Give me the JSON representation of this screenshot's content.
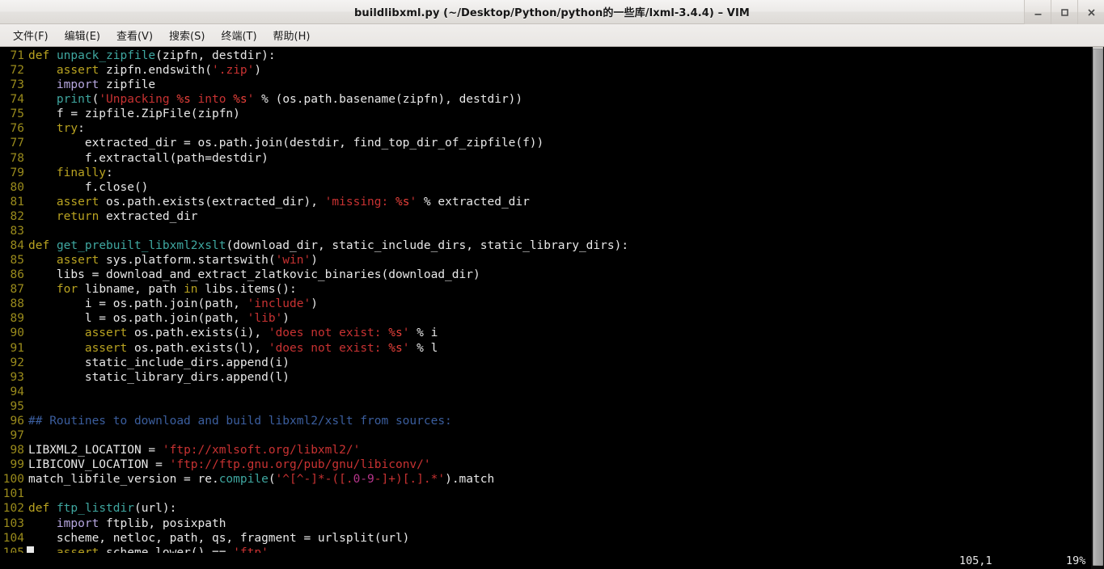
{
  "window": {
    "title": "buildlibxml.py (~/Desktop/Python/python的一些库/lxml-3.4.4) – VIM",
    "controls": {
      "minimize": "minimize-icon",
      "maximize": "maximize-icon",
      "close": "close-icon"
    }
  },
  "menubar": {
    "items": [
      {
        "label": "文件(F)",
        "name": "menu-file"
      },
      {
        "label": "编辑(E)",
        "name": "menu-edit"
      },
      {
        "label": "查看(V)",
        "name": "menu-view"
      },
      {
        "label": "搜索(S)",
        "name": "menu-search"
      },
      {
        "label": "终端(T)",
        "name": "menu-terminal"
      },
      {
        "label": "帮助(H)",
        "name": "menu-help"
      }
    ]
  },
  "colors": {
    "background": "#000000",
    "foreground": "#e8e8e8",
    "line_number": "#9a8b1c",
    "keyword": "#b9a321",
    "function": "#3fa7a0",
    "preproc": "#b7a7e0",
    "string": "#c83232",
    "format_spec": "#e8413b",
    "number": "#b5358a",
    "comment": "#3b5e9e",
    "titlebar": "#eceae8",
    "menubar": "#e9e6e3",
    "scrollbar_thumb": "#a9a9a9"
  },
  "editor": {
    "first_line": 71,
    "last_line": 105,
    "cursor": {
      "line": 105,
      "column": 1
    },
    "lines": [
      {
        "n": "71",
        "tokens": [
          {
            "t": "def",
            "c": "kw"
          },
          {
            "t": " ",
            "c": "norm"
          },
          {
            "t": "unpack_zipfile",
            "c": "fn"
          },
          {
            "t": "(zipfn, destdir):",
            "c": "norm"
          }
        ]
      },
      {
        "n": "72",
        "tokens": [
          {
            "t": "    ",
            "c": "norm"
          },
          {
            "t": "assert",
            "c": "kw"
          },
          {
            "t": " zipfn.endswith(",
            "c": "norm"
          },
          {
            "t": "'.zip'",
            "c": "str"
          },
          {
            "t": ")",
            "c": "norm"
          }
        ]
      },
      {
        "n": "73",
        "tokens": [
          {
            "t": "    ",
            "c": "norm"
          },
          {
            "t": "import",
            "c": "pre"
          },
          {
            "t": " zipfile",
            "c": "norm"
          }
        ]
      },
      {
        "n": "74",
        "tokens": [
          {
            "t": "    ",
            "c": "norm"
          },
          {
            "t": "print",
            "c": "fn"
          },
          {
            "t": "(",
            "c": "norm"
          },
          {
            "t": "'Unpacking ",
            "c": "str"
          },
          {
            "t": "%s",
            "c": "fmt"
          },
          {
            "t": " into ",
            "c": "str"
          },
          {
            "t": "%s",
            "c": "fmt"
          },
          {
            "t": "'",
            "c": "str"
          },
          {
            "t": " % (os.path.basename(zipfn), destdir))",
            "c": "norm"
          }
        ]
      },
      {
        "n": "75",
        "tokens": [
          {
            "t": "    f = zipfile.ZipFile(zipfn)",
            "c": "norm"
          }
        ]
      },
      {
        "n": "76",
        "tokens": [
          {
            "t": "    ",
            "c": "norm"
          },
          {
            "t": "try",
            "c": "kw"
          },
          {
            "t": ":",
            "c": "norm"
          }
        ]
      },
      {
        "n": "77",
        "tokens": [
          {
            "t": "        extracted_dir = os.path.join(destdir, find_top_dir_of_zipfile(f))",
            "c": "norm"
          }
        ]
      },
      {
        "n": "78",
        "tokens": [
          {
            "t": "        f.extractall(path=destdir)",
            "c": "norm"
          }
        ]
      },
      {
        "n": "79",
        "tokens": [
          {
            "t": "    ",
            "c": "norm"
          },
          {
            "t": "finally",
            "c": "kw"
          },
          {
            "t": ":",
            "c": "norm"
          }
        ]
      },
      {
        "n": "80",
        "tokens": [
          {
            "t": "        f.close()",
            "c": "norm"
          }
        ]
      },
      {
        "n": "81",
        "tokens": [
          {
            "t": "    ",
            "c": "norm"
          },
          {
            "t": "assert",
            "c": "kw"
          },
          {
            "t": " os.path.exists(extracted_dir), ",
            "c": "norm"
          },
          {
            "t": "'missing: ",
            "c": "str"
          },
          {
            "t": "%s",
            "c": "fmt"
          },
          {
            "t": "'",
            "c": "str"
          },
          {
            "t": " % extracted_dir",
            "c": "norm"
          }
        ]
      },
      {
        "n": "82",
        "tokens": [
          {
            "t": "    ",
            "c": "norm"
          },
          {
            "t": "return",
            "c": "kw"
          },
          {
            "t": " extracted_dir",
            "c": "norm"
          }
        ]
      },
      {
        "n": "83",
        "tokens": [
          {
            "t": "",
            "c": "norm"
          }
        ]
      },
      {
        "n": "84",
        "tokens": [
          {
            "t": "def",
            "c": "kw"
          },
          {
            "t": " ",
            "c": "norm"
          },
          {
            "t": "get_prebuilt_libxml2xslt",
            "c": "fn"
          },
          {
            "t": "(download_dir, static_include_dirs, static_library_dirs):",
            "c": "norm"
          }
        ]
      },
      {
        "n": "85",
        "tokens": [
          {
            "t": "    ",
            "c": "norm"
          },
          {
            "t": "assert",
            "c": "kw"
          },
          {
            "t": " sys.platform.startswith(",
            "c": "norm"
          },
          {
            "t": "'win'",
            "c": "str"
          },
          {
            "t": ")",
            "c": "norm"
          }
        ]
      },
      {
        "n": "86",
        "tokens": [
          {
            "t": "    libs = download_and_extract_zlatkovic_binaries(download_dir)",
            "c": "norm"
          }
        ]
      },
      {
        "n": "87",
        "tokens": [
          {
            "t": "    ",
            "c": "norm"
          },
          {
            "t": "for",
            "c": "kw"
          },
          {
            "t": " libname, path ",
            "c": "norm"
          },
          {
            "t": "in",
            "c": "kw"
          },
          {
            "t": " libs.items():",
            "c": "norm"
          }
        ]
      },
      {
        "n": "88",
        "tokens": [
          {
            "t": "        i = os.path.join(path, ",
            "c": "norm"
          },
          {
            "t": "'include'",
            "c": "str"
          },
          {
            "t": ")",
            "c": "norm"
          }
        ]
      },
      {
        "n": "89",
        "tokens": [
          {
            "t": "        l = os.path.join(path, ",
            "c": "norm"
          },
          {
            "t": "'lib'",
            "c": "str"
          },
          {
            "t": ")",
            "c": "norm"
          }
        ]
      },
      {
        "n": "90",
        "tokens": [
          {
            "t": "        ",
            "c": "norm"
          },
          {
            "t": "assert",
            "c": "kw"
          },
          {
            "t": " os.path.exists(i), ",
            "c": "norm"
          },
          {
            "t": "'does not exist: ",
            "c": "str"
          },
          {
            "t": "%s",
            "c": "fmt"
          },
          {
            "t": "'",
            "c": "str"
          },
          {
            "t": " % i",
            "c": "norm"
          }
        ]
      },
      {
        "n": "91",
        "tokens": [
          {
            "t": "        ",
            "c": "norm"
          },
          {
            "t": "assert",
            "c": "kw"
          },
          {
            "t": " os.path.exists(l), ",
            "c": "norm"
          },
          {
            "t": "'does not exist: ",
            "c": "str"
          },
          {
            "t": "%s",
            "c": "fmt"
          },
          {
            "t": "'",
            "c": "str"
          },
          {
            "t": " % l",
            "c": "norm"
          }
        ]
      },
      {
        "n": "92",
        "tokens": [
          {
            "t": "        static_include_dirs.append(i)",
            "c": "norm"
          }
        ]
      },
      {
        "n": "93",
        "tokens": [
          {
            "t": "        static_library_dirs.append(l)",
            "c": "norm"
          }
        ]
      },
      {
        "n": "94",
        "tokens": [
          {
            "t": "",
            "c": "norm"
          }
        ]
      },
      {
        "n": "95",
        "tokens": [
          {
            "t": "",
            "c": "norm"
          }
        ]
      },
      {
        "n": "96",
        "tokens": [
          {
            "t": "## Routines to download and build libxml2/xslt from sources:",
            "c": "cmt"
          }
        ]
      },
      {
        "n": "97",
        "tokens": [
          {
            "t": "",
            "c": "norm"
          }
        ]
      },
      {
        "n": "98",
        "tokens": [
          {
            "t": "LIBXML2_LOCATION = ",
            "c": "norm"
          },
          {
            "t": "'ftp://xmlsoft.org/libxml2/'",
            "c": "str"
          }
        ]
      },
      {
        "n": "99",
        "tokens": [
          {
            "t": "LIBICONV_LOCATION = ",
            "c": "norm"
          },
          {
            "t": "'ftp://ftp.gnu.org/pub/gnu/libiconv/'",
            "c": "str"
          }
        ]
      },
      {
        "n": "100",
        "tokens": [
          {
            "t": "match_libfile_version = re.",
            "c": "norm"
          },
          {
            "t": "compile",
            "c": "fn"
          },
          {
            "t": "(",
            "c": "norm"
          },
          {
            "t": "'^[^-]*-([.",
            "c": "str"
          },
          {
            "t": "0-9",
            "c": "num"
          },
          {
            "t": "-]+)[.].*'",
            "c": "str"
          },
          {
            "t": ").match",
            "c": "norm"
          }
        ]
      },
      {
        "n": "101",
        "tokens": [
          {
            "t": "",
            "c": "norm"
          }
        ]
      },
      {
        "n": "102",
        "tokens": [
          {
            "t": "def",
            "c": "kw"
          },
          {
            "t": " ",
            "c": "norm"
          },
          {
            "t": "ftp_listdir",
            "c": "fn"
          },
          {
            "t": "(url):",
            "c": "norm"
          }
        ]
      },
      {
        "n": "103",
        "tokens": [
          {
            "t": "    ",
            "c": "norm"
          },
          {
            "t": "import",
            "c": "pre"
          },
          {
            "t": " ftplib, posixpath",
            "c": "norm"
          }
        ]
      },
      {
        "n": "104",
        "tokens": [
          {
            "t": "    scheme, netloc, path, qs, fragment = urlsplit(url)",
            "c": "norm"
          }
        ]
      },
      {
        "n": "105",
        "tokens": [
          {
            "t": "    ",
            "c": "norm"
          },
          {
            "t": "assert",
            "c": "kw"
          },
          {
            "t": " scheme.lower() == ",
            "c": "norm"
          },
          {
            "t": "'ftp'",
            "c": "str"
          }
        ]
      }
    ]
  },
  "statusline": {
    "ruler": "105,1",
    "percent": "19%"
  },
  "scrollbar": {
    "name": "vertical-scrollbar",
    "position_percent": 19
  }
}
